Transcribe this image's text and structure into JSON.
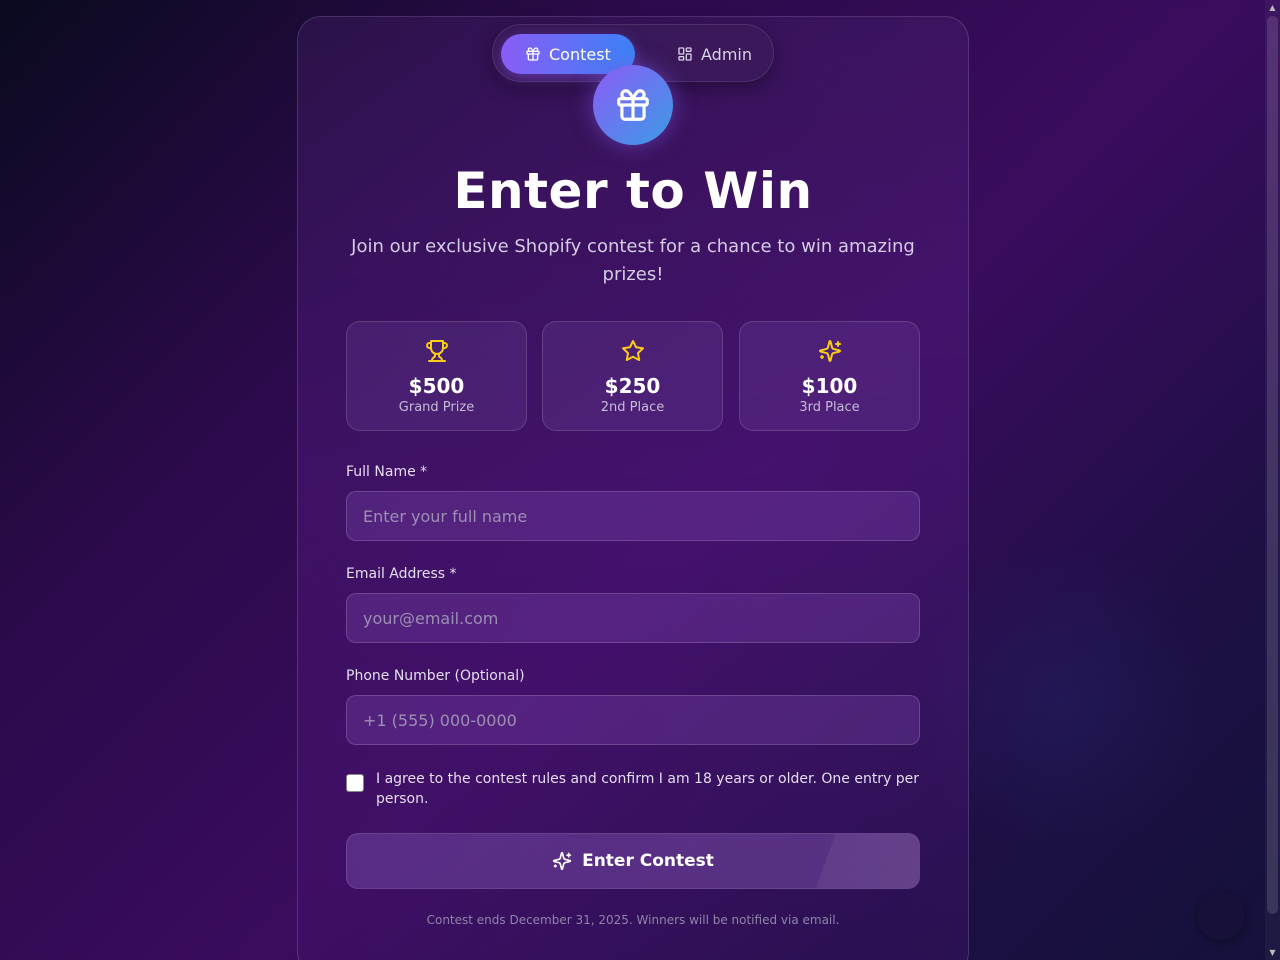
{
  "nav": {
    "tabs": [
      {
        "label": "Contest",
        "icon": "gift-icon",
        "active": true
      },
      {
        "label": "Admin",
        "icon": "dashboard-icon",
        "active": false
      }
    ]
  },
  "hero": {
    "icon": "gift-icon",
    "title": "Enter to Win",
    "subtitle": "Join our exclusive Shopify contest for a chance to win amazing prizes!"
  },
  "prizes": [
    {
      "icon": "trophy-icon",
      "amount": "$500",
      "label": "Grand Prize"
    },
    {
      "icon": "star-icon",
      "amount": "$250",
      "label": "2nd Place"
    },
    {
      "icon": "sparkles-icon",
      "amount": "$100",
      "label": "3rd Place"
    }
  ],
  "form": {
    "name": {
      "label": "Full Name *",
      "placeholder": "Enter your full name",
      "value": ""
    },
    "email": {
      "label": "Email Address *",
      "placeholder": "your@email.com",
      "value": ""
    },
    "phone": {
      "label": "Phone Number (Optional)",
      "placeholder": "+1 (555) 000-0000",
      "value": ""
    },
    "agree": {
      "label": "I agree to the contest rules and confirm I am 18 years or older. One entry per person.",
      "checked": false
    },
    "submit_label": "Enter Contest"
  },
  "footer": {
    "note": "Contest ends December 31, 2025. Winners will be notified via email."
  },
  "colors": {
    "accent_start": "#8b5cf6",
    "accent_end": "#3b82f6",
    "prize_icon": "#facc15"
  }
}
